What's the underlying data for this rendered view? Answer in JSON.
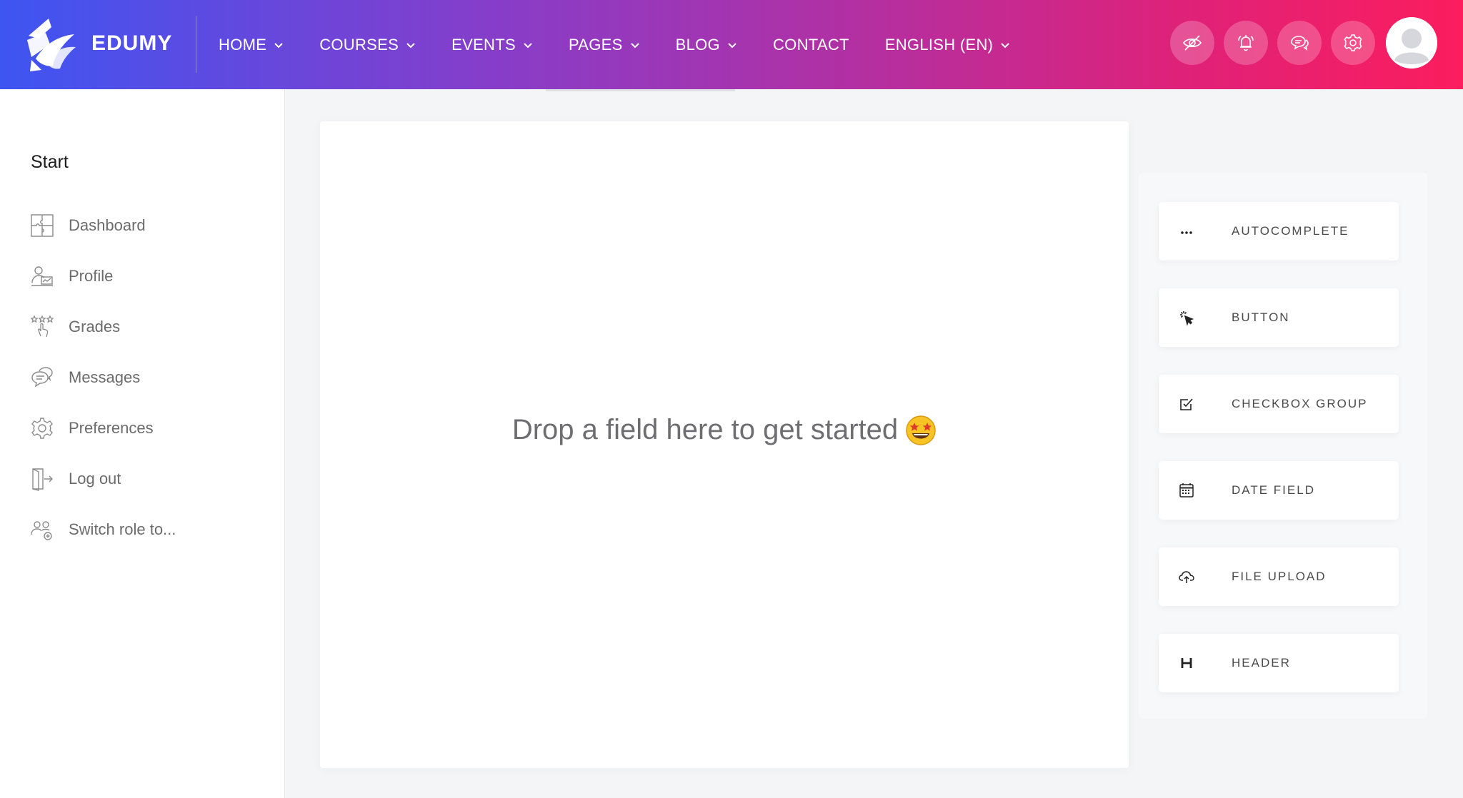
{
  "brand": {
    "name": "EDUMY"
  },
  "nav": {
    "items": [
      {
        "label": "HOME",
        "dropdown": true
      },
      {
        "label": "COURSES",
        "dropdown": true
      },
      {
        "label": "EVENTS",
        "dropdown": true
      },
      {
        "label": "PAGES",
        "dropdown": true
      },
      {
        "label": "BLOG",
        "dropdown": true
      },
      {
        "label": "CONTACT",
        "dropdown": false
      },
      {
        "label": "ENGLISH (EN)",
        "dropdown": true
      }
    ]
  },
  "header_actions": [
    "eye-off-icon",
    "bell-icon",
    "chat-icon",
    "gear-icon",
    "avatar"
  ],
  "sidebar": {
    "heading": "Start",
    "items": [
      {
        "label": "Dashboard",
        "icon": "puzzle-icon"
      },
      {
        "label": "Profile",
        "icon": "profile-icon"
      },
      {
        "label": "Grades",
        "icon": "grades-stars-icon"
      },
      {
        "label": "Messages",
        "icon": "messages-icon"
      },
      {
        "label": "Preferences",
        "icon": "gear-icon"
      },
      {
        "label": "Log out",
        "icon": "logout-icon"
      },
      {
        "label": "Switch role to...",
        "icon": "switch-role-icon"
      }
    ]
  },
  "canvas": {
    "placeholder": "Drop a field here to get started"
  },
  "palette": {
    "fields": [
      {
        "label": "AUTOCOMPLETE",
        "icon": "ellipsis-icon"
      },
      {
        "label": "BUTTON",
        "icon": "cursor-click-icon"
      },
      {
        "label": "CHECKBOX GROUP",
        "icon": "checkbox-icon"
      },
      {
        "label": "DATE FIELD",
        "icon": "calendar-icon"
      },
      {
        "label": "FILE UPLOAD",
        "icon": "cloud-upload-icon"
      },
      {
        "label": "HEADER",
        "icon": "header-h-icon"
      }
    ]
  },
  "colors": {
    "header_gradient_start": "#3e55f2",
    "header_gradient_end": "#fb1d5e",
    "sidebar_bg": "#ffffff",
    "page_bg": "#f4f5f7"
  }
}
